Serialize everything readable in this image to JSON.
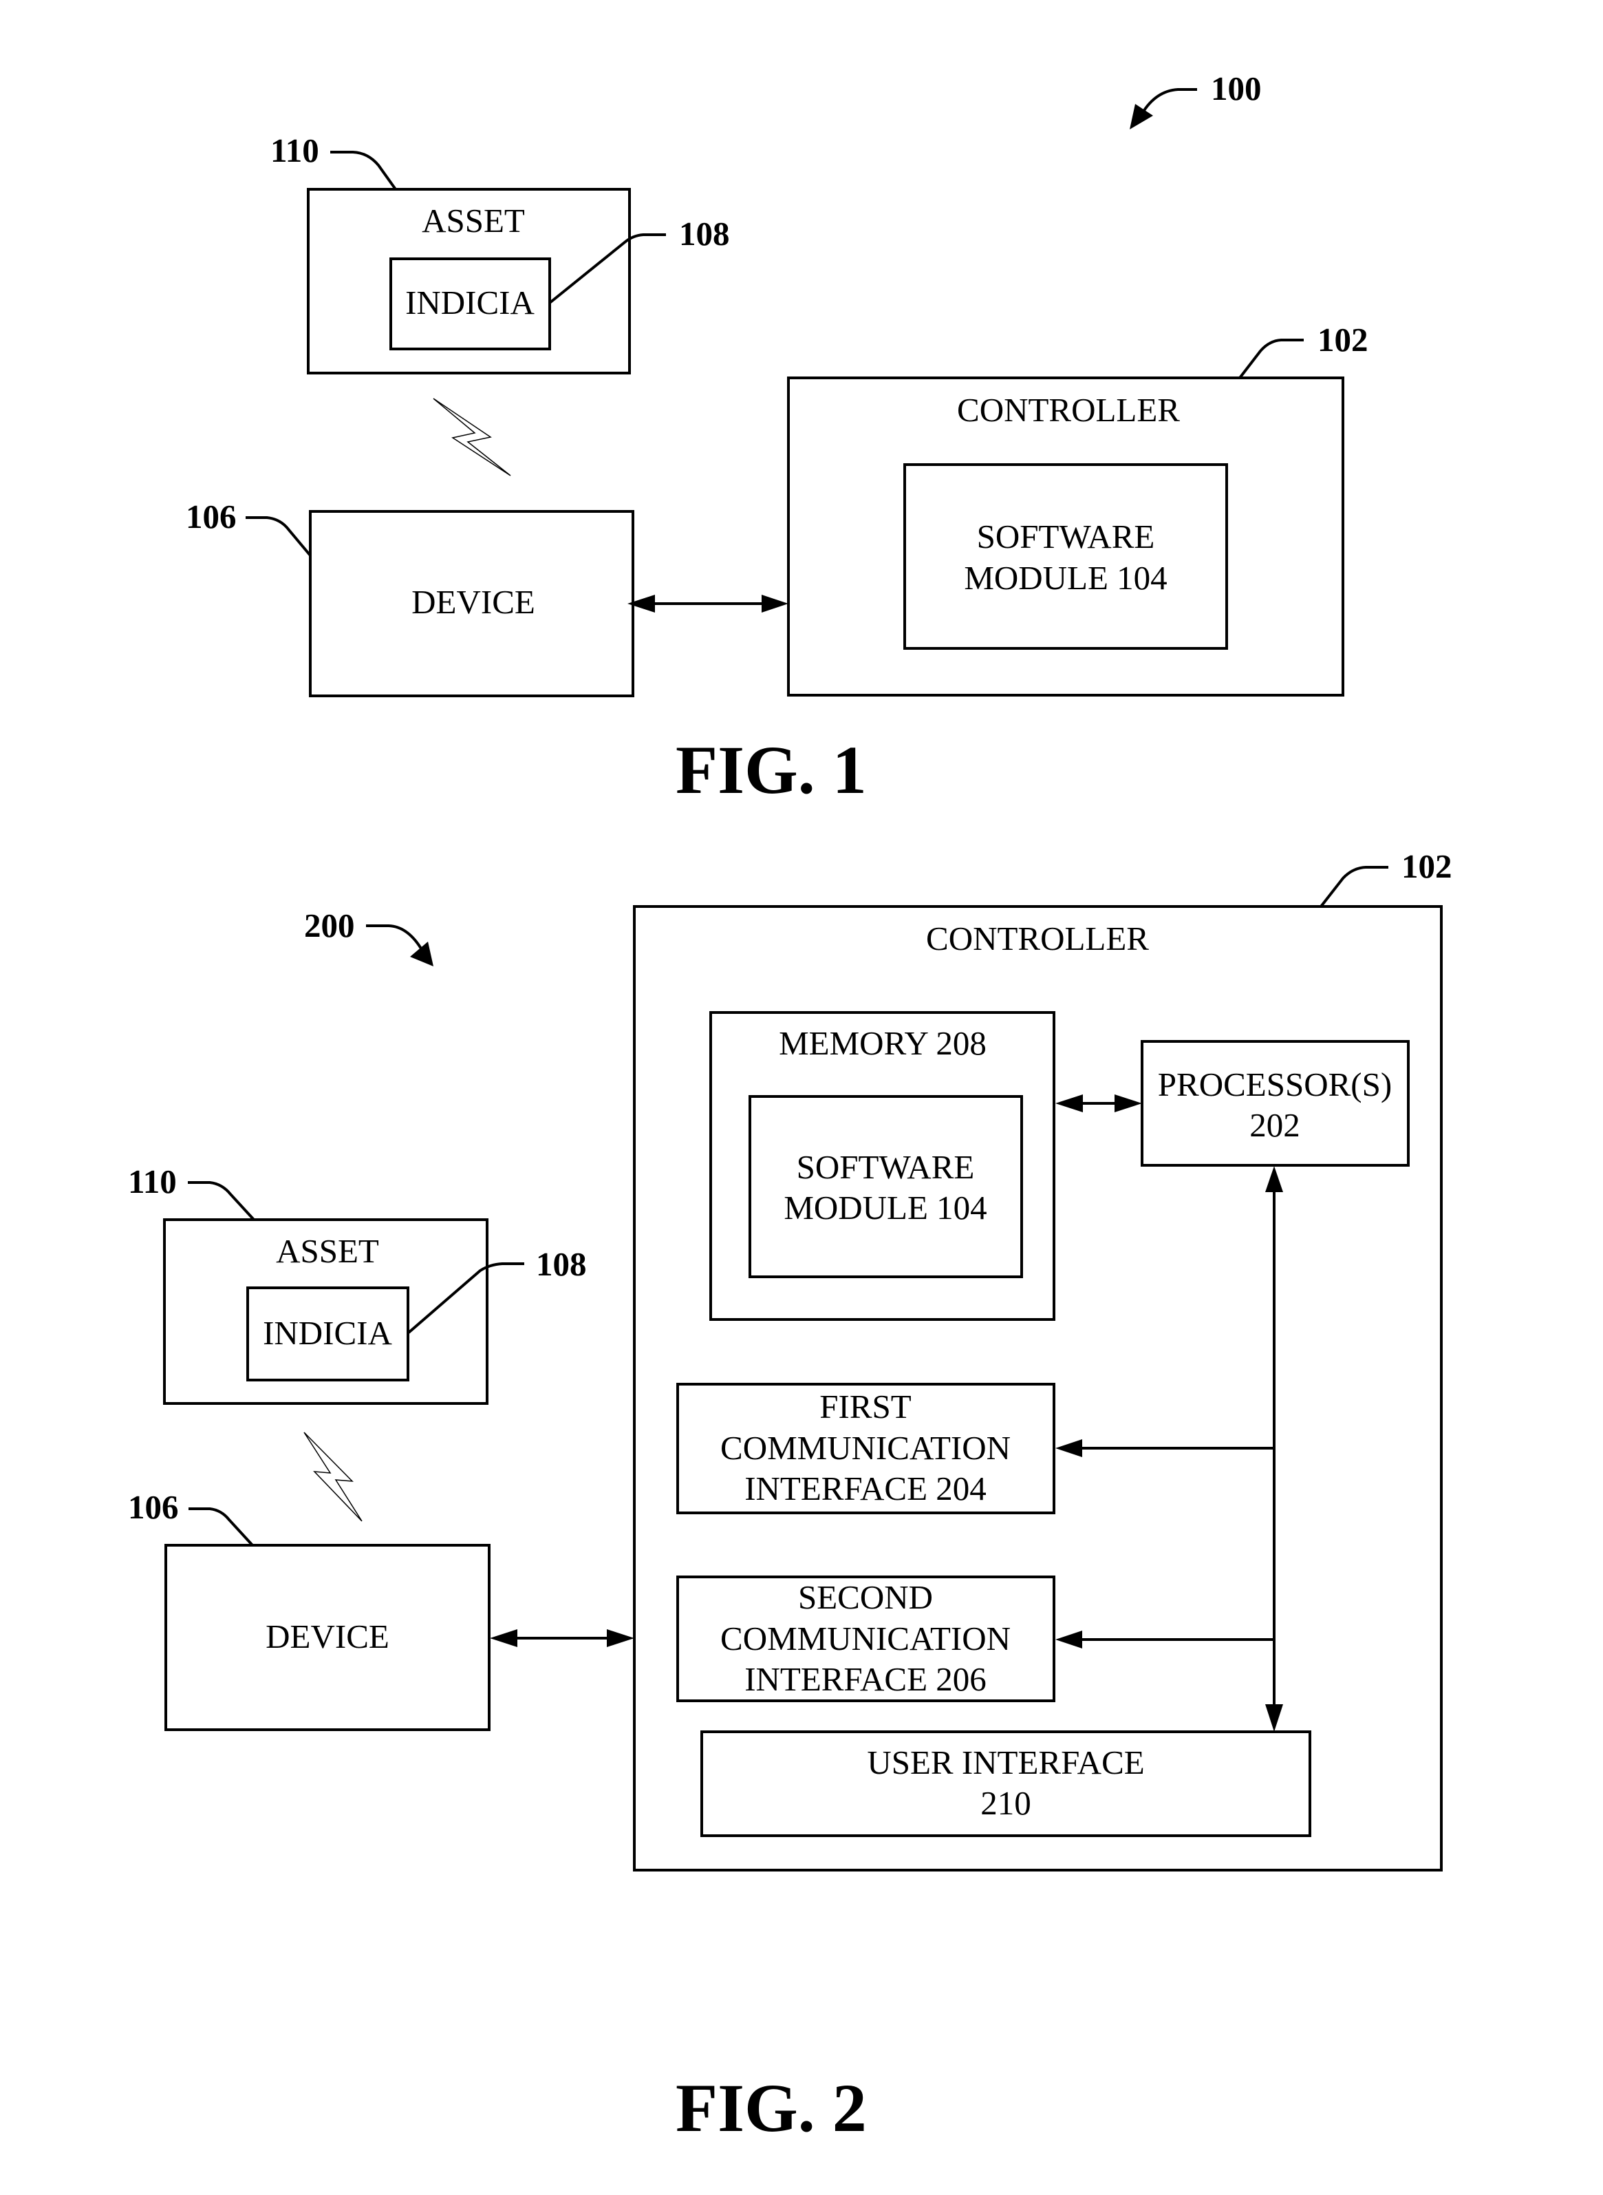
{
  "figure1": {
    "caption": "FIG. 1",
    "system_ref": "100",
    "asset": {
      "label": "ASSET",
      "ref": "110"
    },
    "indicia": {
      "label": "INDICIA",
      "ref": "108"
    },
    "device": {
      "label": "DEVICE",
      "ref": "106"
    },
    "controller": {
      "label": "CONTROLLER",
      "ref": "102"
    },
    "software_module": {
      "lines": [
        "SOFTWARE",
        "MODULE 104"
      ]
    },
    "connections": [
      {
        "from": "asset",
        "to": "device",
        "type": "wireless"
      },
      {
        "from": "device",
        "to": "controller",
        "type": "bidirectional"
      }
    ]
  },
  "figure2": {
    "caption": "FIG. 2",
    "system_ref": "200",
    "asset": {
      "label": "ASSET",
      "ref": "110"
    },
    "indicia": {
      "label": "INDICIA",
      "ref": "108"
    },
    "device": {
      "label": "DEVICE",
      "ref": "106"
    },
    "controller": {
      "label": "CONTROLLER",
      "ref": "102"
    },
    "memory": {
      "label": "MEMORY 208"
    },
    "software_module": {
      "lines": [
        "SOFTWARE",
        "MODULE 104"
      ]
    },
    "processor": {
      "lines": [
        "PROCESSOR(S)",
        "202"
      ]
    },
    "first_comm": {
      "lines": [
        "FIRST",
        "COMMUNICATION",
        "INTERFACE 204"
      ]
    },
    "second_comm": {
      "lines": [
        "SECOND",
        "COMMUNICATION",
        "INTERFACE 206"
      ]
    },
    "user_interface": {
      "lines": [
        "USER INTERFACE",
        "210"
      ]
    },
    "connections": [
      {
        "from": "asset",
        "to": "device",
        "type": "wireless"
      },
      {
        "from": "device",
        "to": "controller",
        "type": "bidirectional"
      },
      {
        "from": "memory",
        "to": "processor",
        "type": "bidirectional"
      },
      {
        "from": "bus",
        "to": "processor",
        "type": "directed"
      },
      {
        "from": "bus",
        "to": "first_comm",
        "type": "directed"
      },
      {
        "from": "bus",
        "to": "second_comm",
        "type": "directed"
      },
      {
        "from": "bus",
        "to": "user_interface",
        "type": "directed"
      }
    ]
  }
}
